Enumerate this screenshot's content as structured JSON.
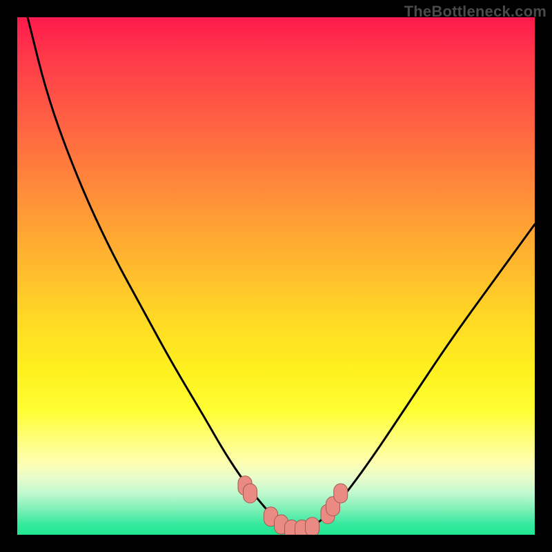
{
  "watermark": "TheBottleneck.com",
  "colors": {
    "frame": "#000000",
    "curve_stroke": "#000000",
    "marker_fill": "#e98b82",
    "marker_stroke": "#a4584f"
  },
  "chart_data": {
    "type": "line",
    "title": "",
    "xlabel": "",
    "ylabel": "",
    "xlim": [
      0,
      100
    ],
    "ylim": [
      0,
      100
    ],
    "grid": false,
    "legend": false,
    "series": [
      {
        "name": "curve",
        "x": [
          2,
          6,
          12,
          18,
          24,
          30,
          36,
          40,
          44,
          48,
          51,
          53,
          55,
          58,
          62,
          68,
          76,
          84,
          92,
          100
        ],
        "y": [
          100,
          84,
          68,
          55,
          44,
          33,
          23,
          16,
          10,
          5,
          2,
          1,
          1,
          2,
          6,
          14,
          26,
          38,
          49,
          60
        ]
      }
    ],
    "markers": [
      {
        "x": 44.0,
        "y": 9.5
      },
      {
        "x": 45.0,
        "y": 8.0
      },
      {
        "x": 49.0,
        "y": 3.5
      },
      {
        "x": 51.0,
        "y": 2.0
      },
      {
        "x": 53.0,
        "y": 1.0
      },
      {
        "x": 55.0,
        "y": 1.0
      },
      {
        "x": 57.0,
        "y": 1.5
      },
      {
        "x": 60.0,
        "y": 4.0
      },
      {
        "x": 61.0,
        "y": 5.5
      },
      {
        "x": 62.5,
        "y": 8.0
      }
    ]
  }
}
